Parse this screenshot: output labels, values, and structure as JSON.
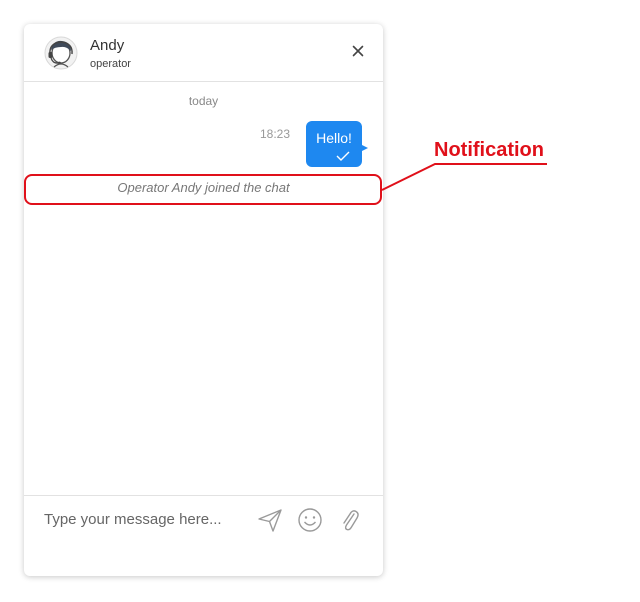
{
  "header": {
    "agent_name": "Andy",
    "agent_role": "operator",
    "avatar_icon": "operator-headset-avatar-icon",
    "close_icon": "close-icon"
  },
  "chat": {
    "date_separator": "today",
    "messages": [
      {
        "time": "18:23",
        "text": "Hello!",
        "status_icon": "check-icon"
      }
    ],
    "notification": "Operator Andy joined the chat"
  },
  "composer": {
    "placeholder": "Type your message here...",
    "send_icon": "send-icon",
    "emoji_icon": "emoji-icon",
    "attach_icon": "paperclip-icon"
  },
  "annotation": {
    "label": "Notification",
    "color": "#e0101a"
  },
  "colors": {
    "bubble": "#1e88f0",
    "accent_annotation": "#e0101a"
  }
}
